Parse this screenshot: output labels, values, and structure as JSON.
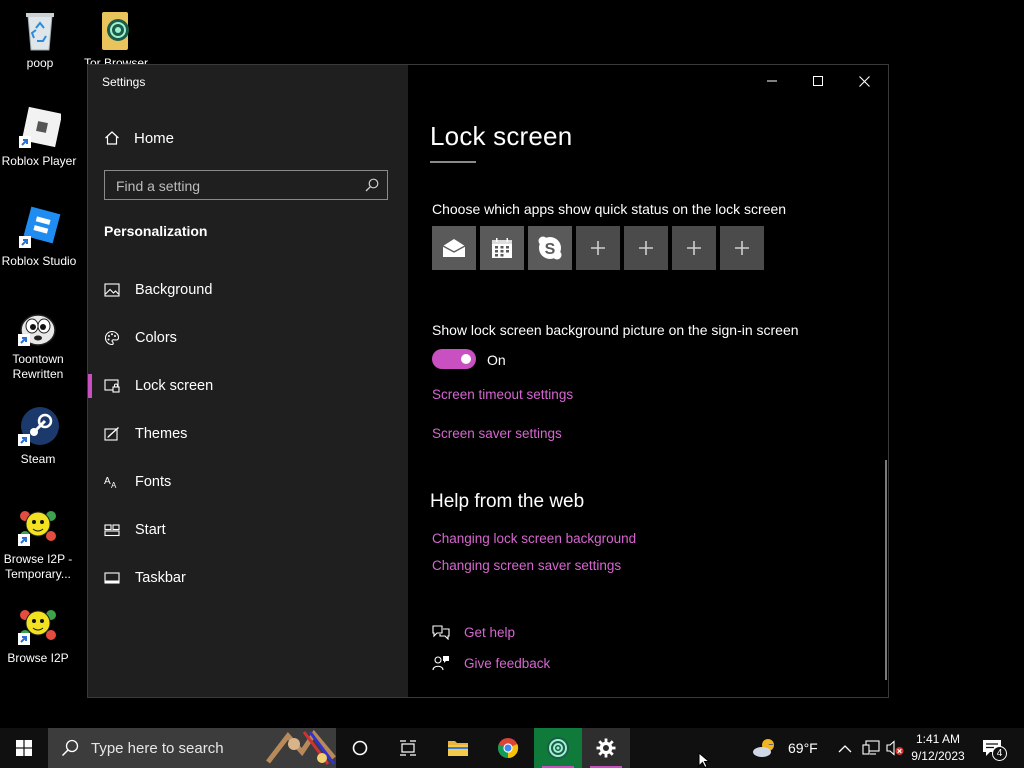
{
  "desktop": {
    "icons": [
      {
        "label": "poop",
        "icon": "recycle-bin-icon"
      },
      {
        "label": "Tor Browser",
        "icon": "tor-browser-icon"
      },
      {
        "label": "Roblox Player",
        "icon": "roblox-player-icon"
      },
      {
        "label": "Roblox Studio",
        "icon": "roblox-studio-icon"
      },
      {
        "label": "Toontown Rewritten",
        "icon": "toontown-icon"
      },
      {
        "label": "Steam",
        "icon": "steam-icon"
      },
      {
        "label": "Browse I2P - Temporary...",
        "icon": "i2p-icon"
      },
      {
        "label": "Browse I2P",
        "icon": "i2p-icon"
      }
    ]
  },
  "window": {
    "title": "Settings",
    "controls": {
      "minimize": "minimize-icon",
      "maximize": "maximize-icon",
      "close": "close-icon"
    }
  },
  "sidebar": {
    "home_label": "Home",
    "search_placeholder": "Find a setting",
    "section_title": "Personalization",
    "items": [
      {
        "label": "Background",
        "icon": "picture-icon",
        "active": false
      },
      {
        "label": "Colors",
        "icon": "palette-icon",
        "active": false
      },
      {
        "label": "Lock screen",
        "icon": "lock-screen-icon",
        "active": true
      },
      {
        "label": "Themes",
        "icon": "themes-icon",
        "active": false
      },
      {
        "label": "Fonts",
        "icon": "fonts-icon",
        "active": false
      },
      {
        "label": "Start",
        "icon": "start-icon",
        "active": false
      },
      {
        "label": "Taskbar",
        "icon": "taskbar-icon",
        "active": false
      }
    ]
  },
  "main": {
    "title": "Lock screen",
    "quick_status_label": "Choose which apps show quick status on the lock screen",
    "quick_status_apps": [
      "mail-icon",
      "calendar-icon",
      "skype-icon",
      "plus-icon",
      "plus-icon",
      "plus-icon",
      "plus-icon"
    ],
    "signin_label": "Show lock screen background picture on the sign-in screen",
    "signin_toggle_state": "On",
    "signin_toggle_on": true,
    "links": {
      "timeout": "Screen timeout settings",
      "screensaver": "Screen saver settings"
    },
    "help": {
      "title": "Help from the web",
      "links": [
        "Changing lock screen background",
        "Changing screen saver settings"
      ],
      "get_help": "Get help",
      "give_feedback": "Give feedback"
    }
  },
  "taskbar": {
    "search_placeholder": "Type here to search",
    "weather": "69°F",
    "time": "1:41 AM",
    "date": "9/12/2023",
    "notification_count": "4"
  },
  "colors": {
    "accent": "#c850c0",
    "link": "#d766d0",
    "sidebar_bg": "#1f1f1f"
  }
}
